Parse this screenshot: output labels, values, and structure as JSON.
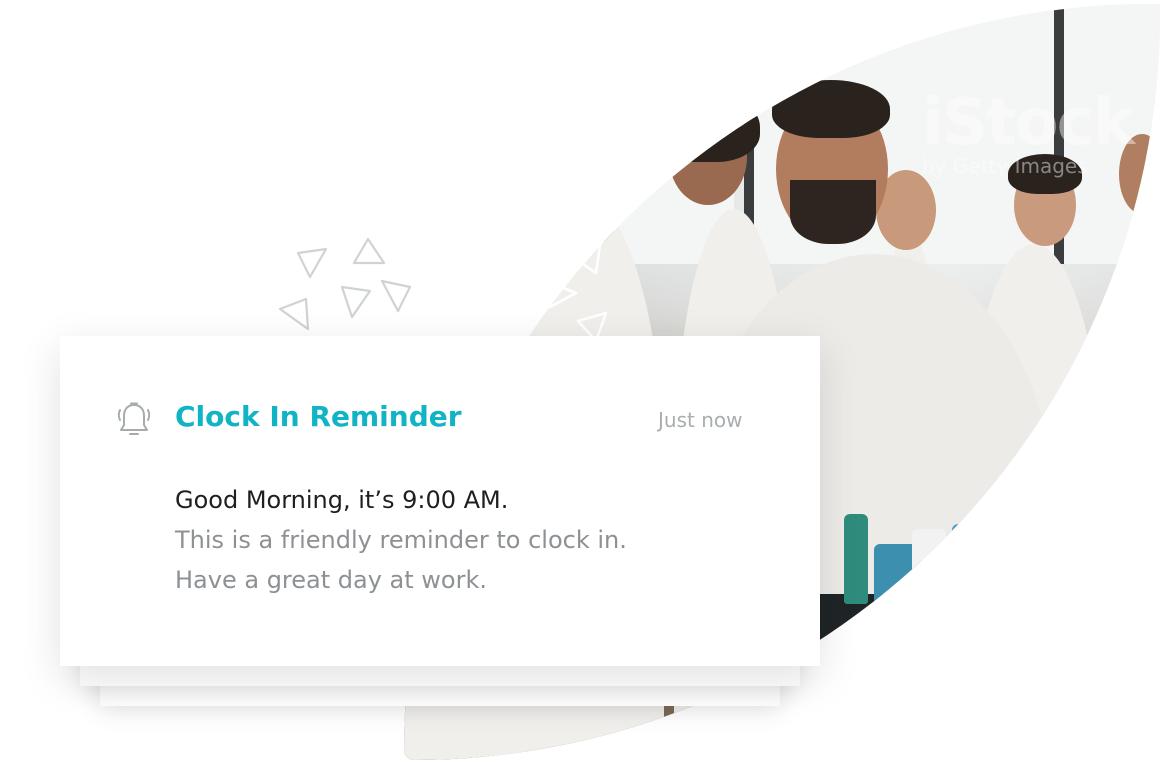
{
  "notification": {
    "title": "Clock In Reminder",
    "timestamp": "Just now",
    "icon": "bell-icon",
    "message_line_1": "Good Morning, it’s 9:00 AM.",
    "message_line_2": "This is a friendly reminder to clock in.",
    "message_line_3": "Have a great day at work.",
    "accent_color": "#11b4c5"
  },
  "photo": {
    "watermark_brand": "iStock",
    "watermark_sub": "by Getty Images",
    "watermark_sub_cropped": "by Getty Imag"
  }
}
